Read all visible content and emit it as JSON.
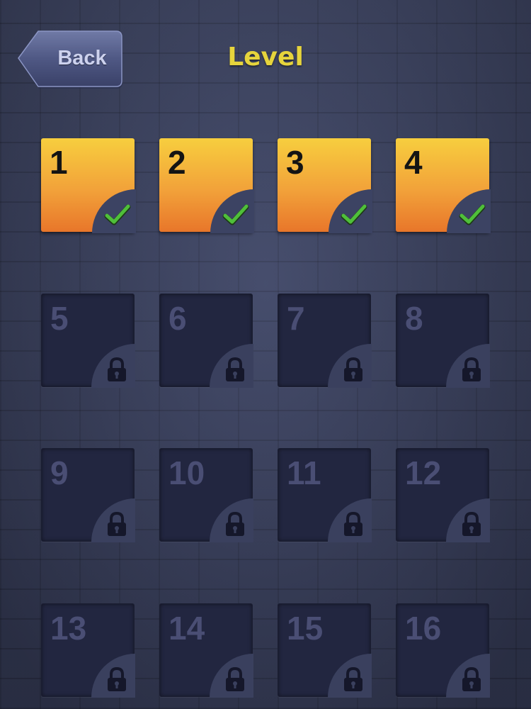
{
  "header": {
    "back_label": "Back",
    "title": "Level"
  },
  "colors": {
    "title": "#e6d43c",
    "unlocked_top": "#f7ce3e",
    "unlocked_bottom": "#e8762a",
    "locked_tile": "#222640",
    "check": "#4fbf3a"
  },
  "levels": [
    {
      "label": "1",
      "status": "completed",
      "icon": "checkmark-icon"
    },
    {
      "label": "2",
      "status": "completed",
      "icon": "checkmark-icon"
    },
    {
      "label": "3",
      "status": "completed",
      "icon": "checkmark-icon"
    },
    {
      "label": "4",
      "status": "completed",
      "icon": "checkmark-icon"
    },
    {
      "label": "5",
      "status": "locked",
      "icon": "lock-icon"
    },
    {
      "label": "6",
      "status": "locked",
      "icon": "lock-icon"
    },
    {
      "label": "7",
      "status": "locked",
      "icon": "lock-icon"
    },
    {
      "label": "8",
      "status": "locked",
      "icon": "lock-icon"
    },
    {
      "label": "9",
      "status": "locked",
      "icon": "lock-icon"
    },
    {
      "label": "10",
      "status": "locked",
      "icon": "lock-icon"
    },
    {
      "label": "11",
      "status": "locked",
      "icon": "lock-icon"
    },
    {
      "label": "12",
      "status": "locked",
      "icon": "lock-icon"
    },
    {
      "label": "13",
      "status": "locked",
      "icon": "lock-icon"
    },
    {
      "label": "14",
      "status": "locked",
      "icon": "lock-icon"
    },
    {
      "label": "15",
      "status": "locked",
      "icon": "lock-icon"
    },
    {
      "label": "16",
      "status": "locked",
      "icon": "lock-icon"
    }
  ]
}
